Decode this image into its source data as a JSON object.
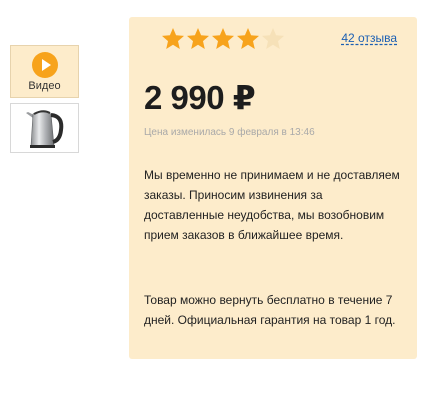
{
  "thumbnails": {
    "video_label": "Видео"
  },
  "rating": {
    "value": 4,
    "max": 5,
    "filled_color": "#f7a31c",
    "empty_color": "#f6e1b8"
  },
  "reviews_link": "42 отзыва",
  "price": "2 990 ₽",
  "price_changed": "Цена изменилась 9 февраля в 13:46",
  "notice_unavailable": "Мы временно не принимаем и не доставляем заказы. Приносим извинения за доставленные неудобства, мы возобновим прием заказов в ближайшее время.",
  "notice_return": "Товар можно вернуть бесплатно в течение 7 дней. Официальная гарантия на товар 1 год.",
  "colors": {
    "panel_bg": "#fdeccb",
    "link": "#1b5fb3",
    "muted": "#a9a9a9"
  }
}
